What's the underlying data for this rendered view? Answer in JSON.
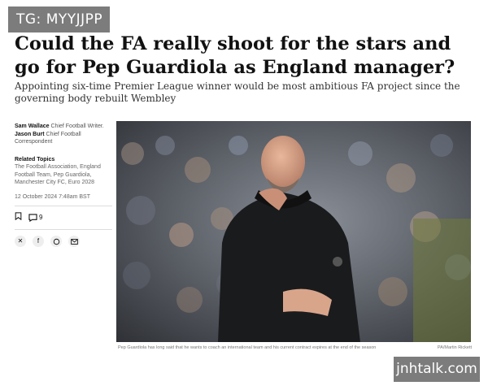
{
  "badge": {
    "text": "TG: MYYJJPP"
  },
  "article": {
    "headline": "Could the FA really shoot for the stars and go for Pep Guardiola as England manager?",
    "standfirst": "Appointing six-time Premier League winner would be most ambitious FA project since the governing body rebuilt Wembley"
  },
  "sidebar": {
    "authors": [
      {
        "name": "Sam Wallace",
        "role": "Chief Football Writer."
      },
      {
        "name": "Jason Burt",
        "role": "Chief Football Correspondent"
      }
    ],
    "related_topics_label": "Related Topics",
    "related_topics": "The Football Association, England Football Team, Pep Guardiola, Manchester City FC, Euro 2028",
    "date": "12 October 2024 7:48am BST",
    "comment_count": "9",
    "icons": [
      "bookmark-icon",
      "comment-icon",
      "x-icon",
      "facebook-icon",
      "whatsapp-icon",
      "email-icon"
    ]
  },
  "photo": {
    "caption": "Pep Guardiola has long said that he wants to coach an international team and his current contract expires at the end of the season",
    "credit": "PA/Martin Rickett"
  },
  "watermark": {
    "text": "jnhtalk.com"
  }
}
